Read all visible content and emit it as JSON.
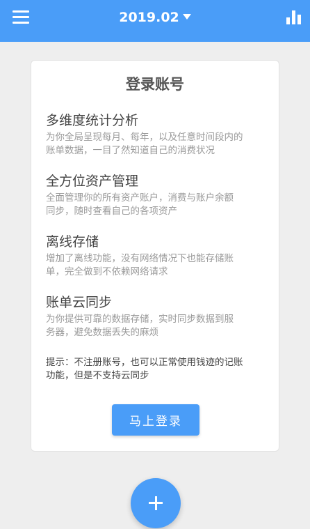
{
  "header": {
    "title": "2019.02",
    "menu_icon": "menu-icon",
    "stats_icon": "bar-chart-icon",
    "accent_color": "#4a9df8"
  },
  "card": {
    "title": "登录账号",
    "features": [
      {
        "title": "多维度统计分析",
        "desc_lines": [
          "为你全局呈现每月、每年，以及任意时间段内的",
          "账单数据，一目了然知道自己的消费状况"
        ]
      },
      {
        "title": "全方位资产管理",
        "desc_lines": [
          "全面管理你的所有资产账户，消费与账户余额",
          "同步，随时查看自己的各项资产"
        ]
      },
      {
        "title": "离线存储",
        "desc_lines": [
          "增加了离线功能，没有网络情况下也能存储账",
          "单，完全做到不依赖网络请求"
        ]
      },
      {
        "title": "账单云同步",
        "desc_lines": [
          "为你提供可靠的数据存储，实时同步数据到服",
          "务器，避免数据丢失的麻烦"
        ]
      }
    ],
    "hint_lines": [
      "提示：不注册账号，也可以正常使用钱迹的记账",
      "功能，但是不支持云同步"
    ],
    "login_button": "马上登录"
  },
  "fab": {
    "icon": "plus-icon"
  }
}
